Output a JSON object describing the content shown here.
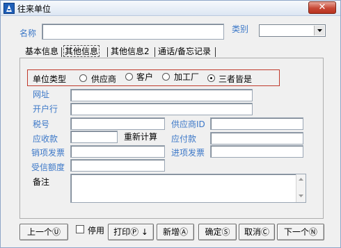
{
  "window": {
    "title": "往来单位",
    "close_label": "✕"
  },
  "header": {
    "name_label": "名称",
    "name_value": "",
    "category_label": "类别",
    "category_value": ""
  },
  "tabs": [
    {
      "label": "基本信息",
      "active": false
    },
    {
      "label": "其他信息",
      "active": true
    },
    {
      "label": "其他信息2",
      "active": false
    },
    {
      "label": "通话/备忘记录",
      "active": false
    }
  ],
  "unit_type": {
    "label": "单位类型",
    "options": [
      {
        "label": "供应商",
        "checked": false
      },
      {
        "label": "客户",
        "checked": false
      },
      {
        "label": "加工厂",
        "checked": false
      },
      {
        "label": "三者皆是",
        "checked": true
      }
    ]
  },
  "fields": {
    "website_label": "网址",
    "website_value": "",
    "bank_label": "开户行",
    "bank_value": "",
    "tax_label": "税号",
    "tax_value": "",
    "supplier_id_label": "供应商ID",
    "supplier_id_value": "",
    "receivable_label": "应收款",
    "receivable_value": "",
    "recalc_label": "重新计算",
    "payable_label": "应付款",
    "payable_value": "",
    "sales_invoice_label": "销项发票",
    "sales_invoice_value": "",
    "purchase_invoice_label": "进项发票",
    "purchase_invoice_value": "",
    "credit_label": "受信额度",
    "credit_value": "",
    "notes_label": "备注",
    "notes_value": ""
  },
  "footer": {
    "prev_label": "上一个Ⓤ",
    "disable_label": "停用",
    "print_label": "打印Ⓟ ↓",
    "new_label": "新增Ⓐ",
    "ok_label": "确定Ⓢ",
    "cancel_label": "取消Ⓒ",
    "next_label": "下一个Ⓝ"
  }
}
